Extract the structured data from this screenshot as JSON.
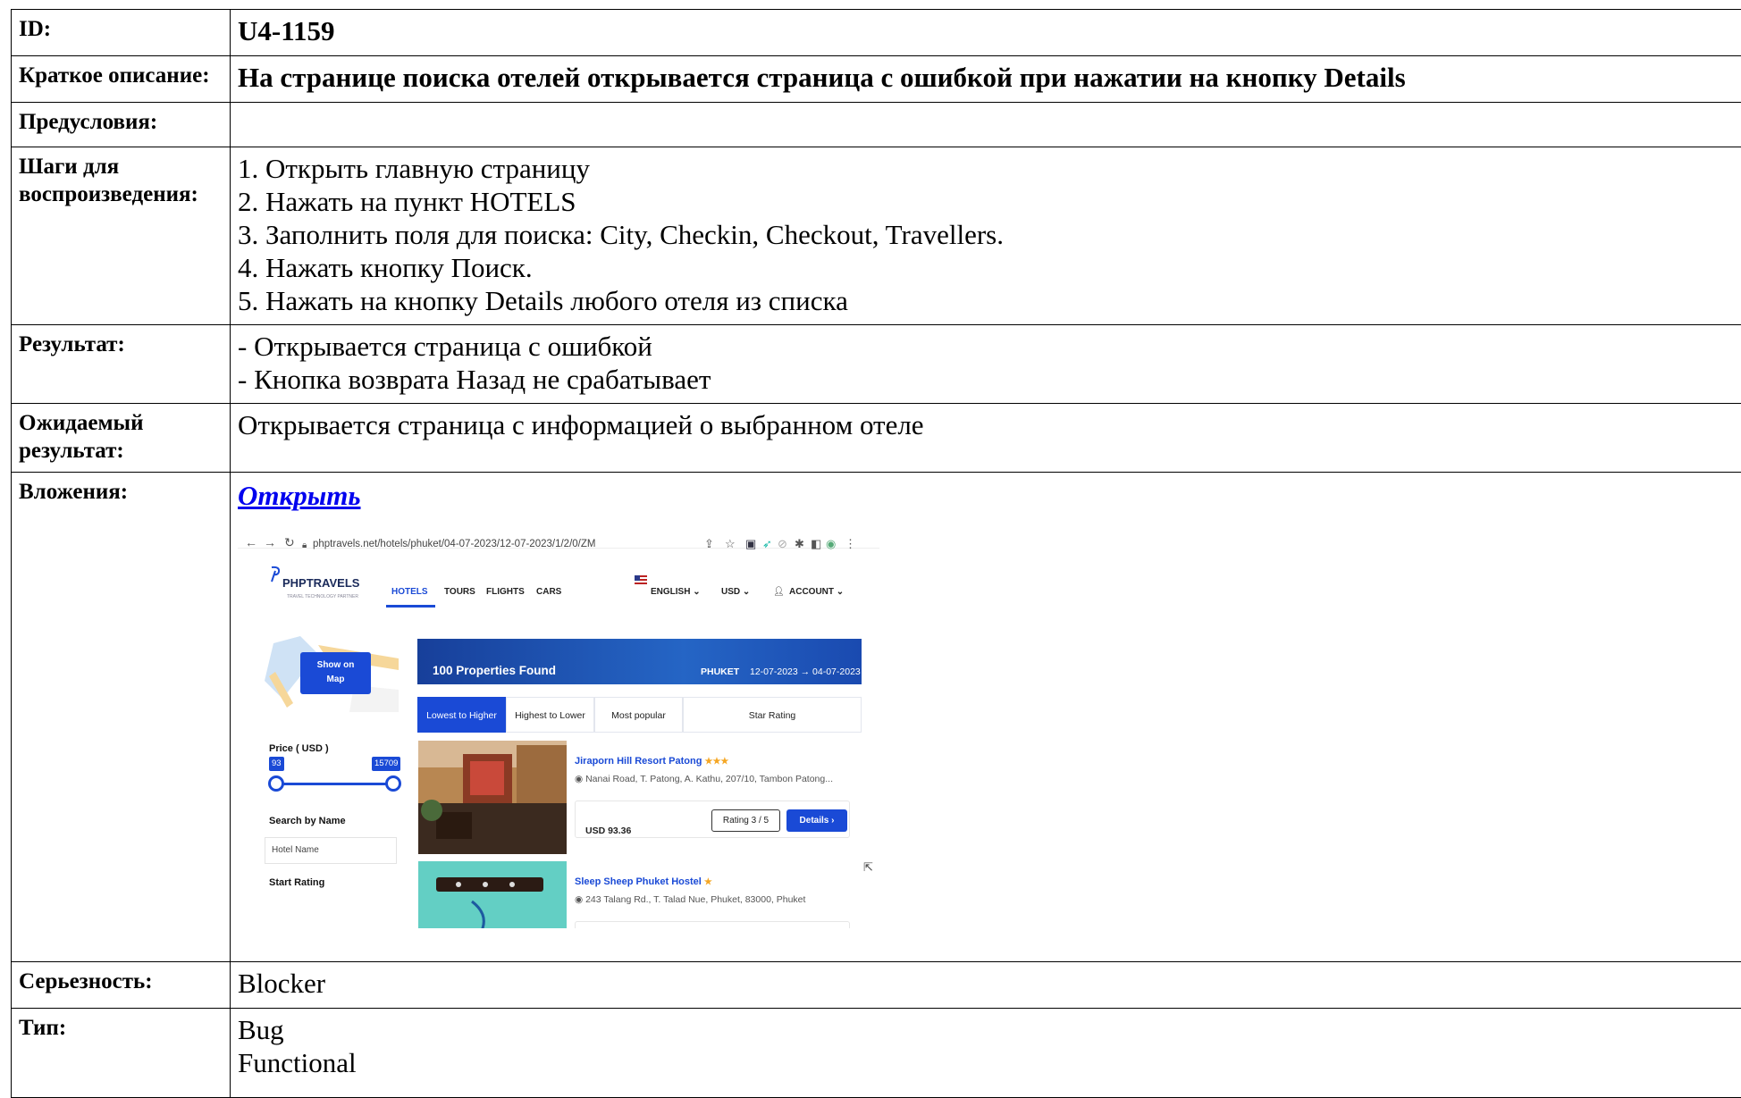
{
  "rows": {
    "id": {
      "label": "ID:",
      "value": "U4-1159"
    },
    "summary": {
      "label": "Краткое описание:",
      "value": "На странице поиска отелей открывается страница с ошибкой при нажатии на кнопку Details"
    },
    "preconditions": {
      "label": "Предусловия:",
      "value": ""
    },
    "steps": {
      "label_line1": "Шаги для",
      "label_line2": "воспроизведения:",
      "items": [
        "1. Открыть главную страницу",
        "2. Нажать на пункт HOTELS",
        "3. Заполнить поля для поиска: City, Checkin, Checkout, Travellers.",
        "4. Нажать кнопку Поиск.",
        "5. Нажать на кнопку Details любого отеля из списка"
      ]
    },
    "result": {
      "label": "Результат:",
      "items": [
        "- Открывается страница с ошибкой",
        "- Кнопка возврата Назад не срабатывает"
      ]
    },
    "expected": {
      "label_line1": "Ожидаемый",
      "label_line2": "результат:",
      "value": "Открывается страница с информацией о выбранном отеле"
    },
    "attachments": {
      "label": "Вложения:",
      "link": "Открыть"
    },
    "severity": {
      "label": "Серьезность:",
      "value": "Blocker"
    },
    "type": {
      "label": "Тип:",
      "items": [
        "Bug",
        "Functional"
      ]
    }
  },
  "screenshot": {
    "url": "phptravels.net/hotels/phuket/04-07-2023/12-07-2023/1/2/0/ZM",
    "logo": "PHPTRAVELS",
    "logo_sub": "TRAVEL TECHNOLOGY PARTNER",
    "menu": [
      "HOTELS",
      "TOURS",
      "FLIGHTS",
      "CARS"
    ],
    "language": "ENGLISH",
    "currency": "USD",
    "account": "ACCOUNT",
    "map_button": [
      "Show on",
      "Map"
    ],
    "found": "100 Properties Found",
    "city": "PHUKET",
    "dates": "12-07-2023 → 04-07-2023",
    "sort": [
      "Lowest to Higher",
      "Highest to Lower",
      "Most popular",
      "Star Rating"
    ],
    "price_heading": "Price ( USD )",
    "price_min": "93",
    "price_max": "15709",
    "search_by_name": "Search by Name",
    "hotel_name_placeholder": "Hotel Name",
    "start_rating": "Start Rating",
    "hotels": [
      {
        "name": "Jiraporn Hill Resort Patong",
        "stars": "★★★",
        "address": "Nanai Road, T. Patong, A. Kathu, 207/10, Tambon Patong...",
        "price": "USD 93.36",
        "rating": "Rating 3 / 5",
        "details": "Details ›"
      },
      {
        "name": "Sleep Sheep Phuket Hostel",
        "stars": "★",
        "address": "243 Talang Rd., T. Talad Nue, Phuket, 83000, Phuket"
      }
    ]
  }
}
